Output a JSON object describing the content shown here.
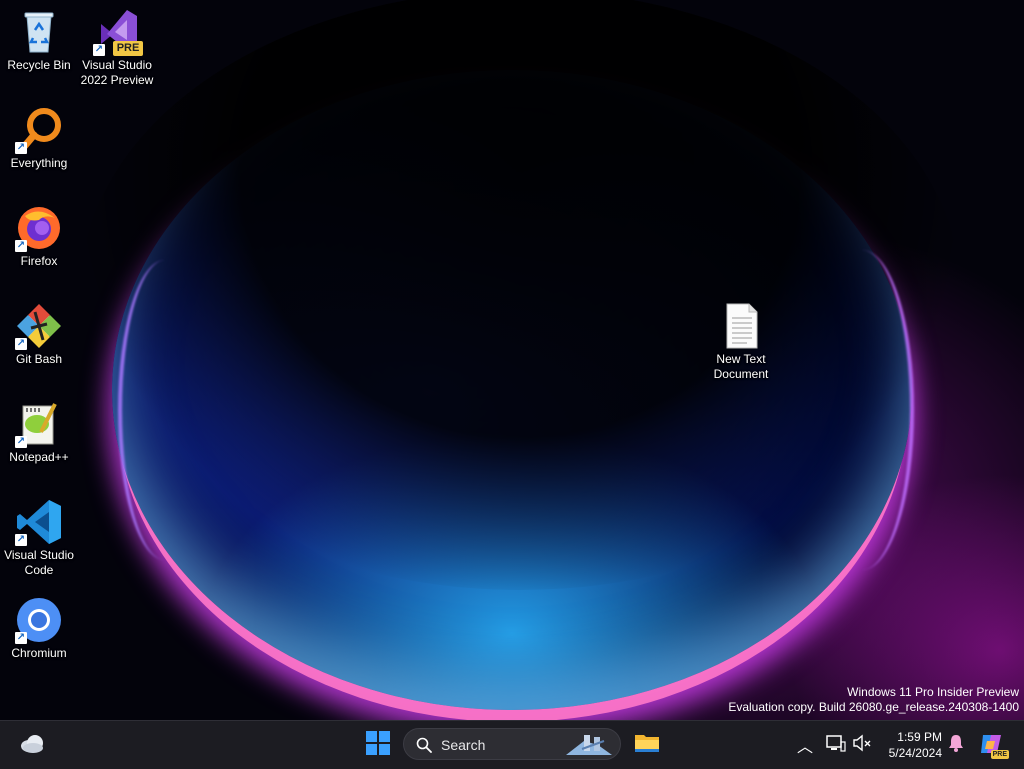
{
  "desktop": {
    "icons": [
      {
        "label": "Recycle Bin",
        "icon": "recycle-bin-icon"
      },
      {
        "label": "Visual Studio 2022 Preview",
        "icon": "visual-studio-preview-icon",
        "badge": "PRE"
      },
      {
        "label": "Everything",
        "icon": "everything-search-icon"
      },
      {
        "label": "Firefox",
        "icon": "firefox-icon"
      },
      {
        "label": "Git Bash",
        "icon": "git-bash-icon"
      },
      {
        "label": "Notepad++",
        "icon": "notepad-plus-plus-icon"
      },
      {
        "label": "Visual Studio Code",
        "icon": "vscode-icon"
      },
      {
        "label": "Chromium",
        "icon": "chromium-icon"
      },
      {
        "label": "New Text Document",
        "icon": "text-document-icon"
      }
    ]
  },
  "watermark": {
    "line1": "Windows 11 Pro Insider Preview",
    "line2": "Evaluation copy. Build 26080.ge_release.240308-1400"
  },
  "taskbar": {
    "search_placeholder": "Search",
    "clock": {
      "time": "1:59 PM",
      "date": "5/24/2024"
    },
    "copilot_badge": "PRE"
  },
  "colors": {
    "taskbar_bg": "#1c1c22",
    "windows_blue": "#3aa0ff",
    "vs_purple": "#8a4fd6",
    "pre_badge": "#f2c744"
  }
}
